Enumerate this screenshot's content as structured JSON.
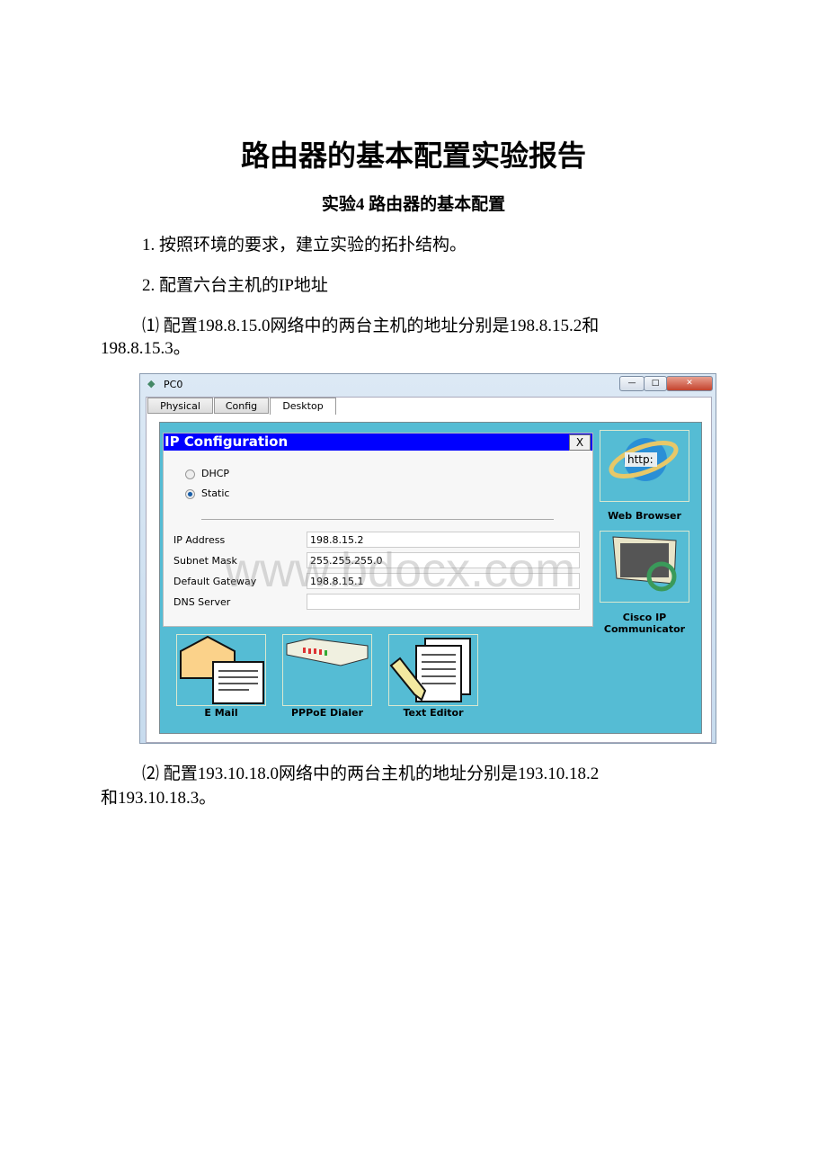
{
  "title": "路由器的基本配置实验报告",
  "subtitle": "实验4  路由器的基本配置",
  "paragraphs": {
    "p1": "1. 按照环境的要求，建立实验的拓扑结构。",
    "p2": "2. 配置六台主机的IP地址",
    "p3a": "⑴ 配置198.8.15.0网络中的两台主机的地址分别是198.8.15.2和",
    "p3b": "198.8.15.3。",
    "p4a": "⑵ 配置193.10.18.0网络中的两台主机的地址分别是193.10.18.2",
    "p4b": "和193.10.18.3。"
  },
  "window": {
    "title": "PC0",
    "tabs": [
      {
        "label": "Physical"
      },
      {
        "label": "Config"
      },
      {
        "label": "Desktop",
        "active": true
      }
    ],
    "dialog": {
      "title": "IP Configuration",
      "close": "X",
      "options": [
        {
          "label": "DHCP",
          "selected": false
        },
        {
          "label": "Static",
          "selected": true
        }
      ],
      "fields": [
        {
          "label": "IP Address",
          "value": "198.8.15.2"
        },
        {
          "label": "Subnet Mask",
          "value": "255.255.255.0"
        },
        {
          "label": "Default Gateway",
          "value": "198.8.15.1"
        },
        {
          "label": "DNS Server",
          "value": ""
        }
      ]
    },
    "apps": {
      "web": "Web Browser",
      "cisco1": "Cisco IP",
      "cisco2": "Communicator",
      "email": "E Mail",
      "pppoe": "PPPoE Dialer",
      "text": "Text Editor"
    },
    "desktop_color": "#55bcd4",
    "dialog_header_color": "#0000ff"
  },
  "watermark": "www.bdocx.com"
}
